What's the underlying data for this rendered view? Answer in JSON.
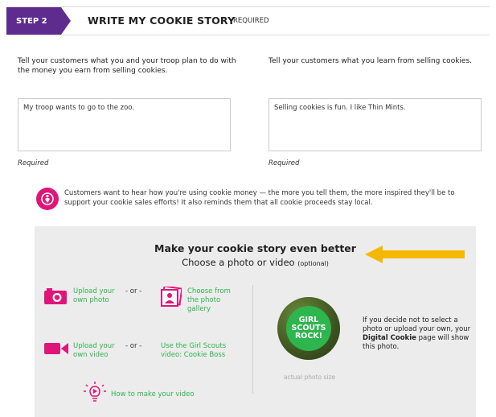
{
  "header": {
    "step_label": "STEP 2",
    "title": "WRITE MY COOKIE STORY",
    "required_label": "REQUIRED"
  },
  "left_section": {
    "prompt": "Tell your customers what you and your troop plan to do with the money you earn from selling cookies.",
    "value": "My troop wants to go to the zoo.",
    "required_label": "Required"
  },
  "right_section": {
    "prompt": "Tell your customers what you learn from selling cookies.",
    "value": "Selling cookies is fun. I like Thin Mints.",
    "required_label": "Required"
  },
  "tip": {
    "text": "Customers want to hear how you're using cookie money — the more you tell them, the more inspired they'll be to support your cookie sales efforts! It also reminds them that all cookie proceeds stay local."
  },
  "panel": {
    "title": "Make your cookie story even better",
    "subtitle": "Choose a photo or video",
    "subtitle_optional": "(optional)",
    "upload_photo": "Upload your own photo",
    "or_1": "- or -",
    "choose_gallery": "Choose from the photo gallery",
    "upload_video": "Upload your own video",
    "or_2": "- or -",
    "gs_video": "Use the Girl Scouts video: Cookie Boss",
    "how_to": "How to make your video",
    "badge_text": "GIRL SCOUTS ROCK!",
    "badge_caption": "actual photo size",
    "note_pre": "If you decide not to select a photo or upload your own, your",
    "note_bold": "Digital Cookie",
    "note_post": "page will show this photo."
  },
  "colors": {
    "purple": "#5e2b8f",
    "green": "#2db54e",
    "pink": "#e0157a",
    "arrow": "#f5b800",
    "panel_bg": "#ececec"
  }
}
